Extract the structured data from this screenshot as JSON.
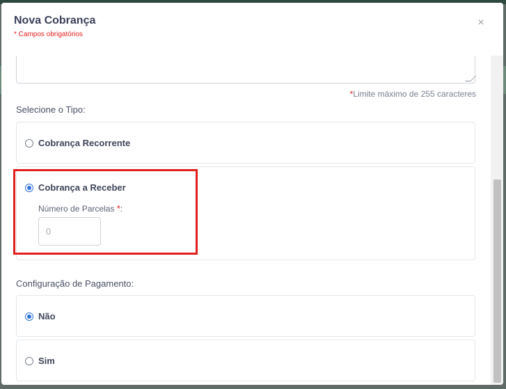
{
  "modal": {
    "title": "Nova Cobrança",
    "required_note": "* Campos obrigatórios",
    "close_label": "×"
  },
  "description": {
    "char_limit_star": "*",
    "char_limit": "Limite máximo de 255 caracteres"
  },
  "tipo": {
    "label": "Selecione o Tipo:",
    "options": [
      {
        "label": "Cobrança Recorrente",
        "selected": false
      },
      {
        "label": "Cobrança a Receber",
        "selected": true
      }
    ],
    "parcelas_label": "Número de Parcelas",
    "parcelas_star": "*",
    "parcelas_colon": ":",
    "parcelas_placeholder": "0"
  },
  "pagamento": {
    "label": "Configuração de Pagamento:",
    "options": [
      {
        "label": "Não",
        "selected": true
      },
      {
        "label": "Sim",
        "selected": false
      }
    ]
  },
  "colors": {
    "accent": "#2f6fd6",
    "required": "#e02020",
    "highlight": "#e01e1e"
  }
}
